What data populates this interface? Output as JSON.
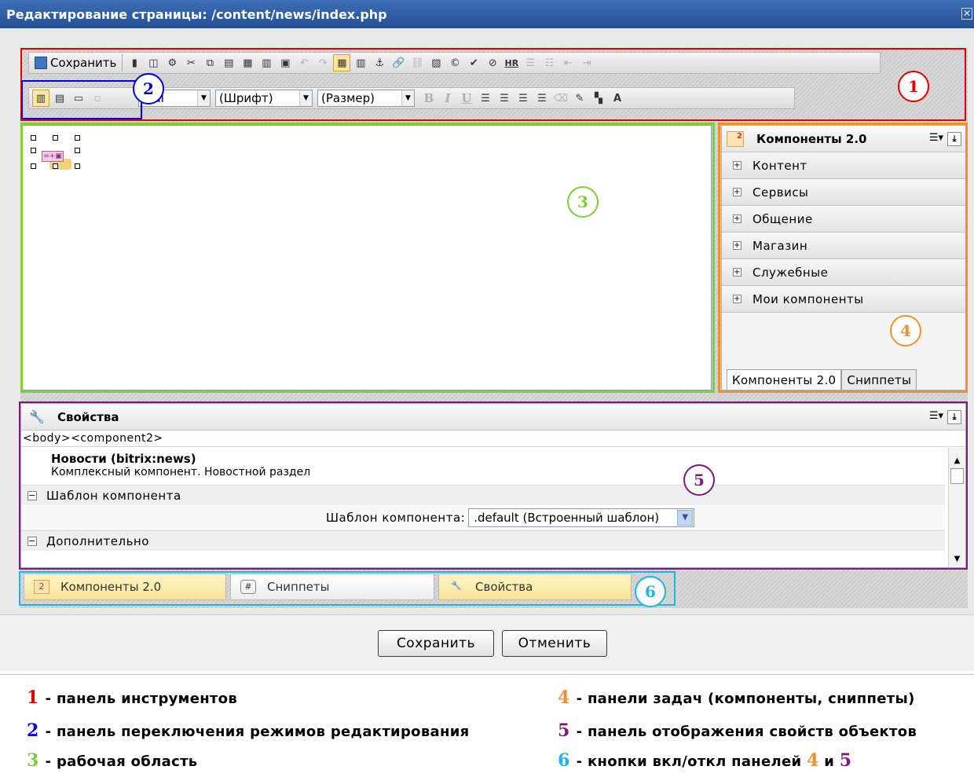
{
  "window": {
    "title": "Редактирование страницы: /content/news/index.php",
    "close_glyph": "✕"
  },
  "toolbar": {
    "save_label": "Сохранить",
    "style_select": "mal",
    "font_select": "(Шрифт)",
    "size_select": "(Размер)",
    "row1_icons": [
      "page-icon",
      "frame-icon",
      "settings-icon",
      "cut-icon",
      "copy-icon",
      "paste-icon",
      "paste-word-icon",
      "paste-text-icon",
      "select-all-icon",
      "undo-icon",
      "redo-icon",
      "table-border-icon",
      "table-icon",
      "anchor-icon",
      "link-icon",
      "unlink-icon",
      "image-icon",
      "copyright-icon",
      "spellcheck-icon",
      "flash-icon",
      "hr-icon",
      "ordered-list-icon",
      "unordered-list-icon",
      "outdent-icon",
      "indent-icon"
    ],
    "hr_label": "HR",
    "bold": "B",
    "italic": "I",
    "underline": "U",
    "mode_icons": [
      "wysiwyg-mode-icon",
      "code-mode-icon",
      "split-mode-icon",
      "compare-mode-icon"
    ]
  },
  "workarea": {
    "component_icon_text": "=+▣"
  },
  "components_panel": {
    "title": "Компоненты 2.0",
    "icon_text": "2",
    "groups": [
      "Контент",
      "Сервисы",
      "Общение",
      "Магазин",
      "Служебные",
      "Мои компоненты"
    ],
    "tabs": [
      "Компоненты 2.0",
      "Сниппеты"
    ],
    "menu_glyph": "☰▾",
    "pin_glyph": "⤓"
  },
  "properties_panel": {
    "title": "Свойства",
    "path": "<body><component2>",
    "component_name": "Новости (bitrix:news)",
    "component_desc": "Комплексный компонент. Новостной раздел",
    "section1": "Шаблон компонента",
    "template_label": "Шаблон компонента:",
    "template_value": ".default (Встроенный шаблон)",
    "section2": "Дополнительно"
  },
  "panel_toggles": [
    {
      "label": "Компоненты 2.0",
      "state": "on",
      "icon": "2"
    },
    {
      "label": "Сниппеты",
      "state": "off",
      "icon": "#"
    },
    {
      "label": "Свойства",
      "state": "on",
      "icon": "🔧"
    }
  ],
  "dialog_buttons": {
    "save": "Сохранить",
    "cancel": "Отменить"
  },
  "markers": [
    "1",
    "2",
    "3",
    "4",
    "5",
    "6"
  ],
  "legend": [
    {
      "num": "1",
      "text": "- панель инструментов",
      "color": "#e00000"
    },
    {
      "num": "2",
      "text": "- панель переключения режимов редактирования",
      "color": "#0000e0"
    },
    {
      "num": "3",
      "text": "- рабочая область",
      "color": "#7ccf3b"
    },
    {
      "num": "4",
      "text": "- панели задач (компоненты, сниппеты)",
      "color": "#f0902a"
    },
    {
      "num": "5",
      "text": "- панель отображения свойств объектов",
      "color": "#7a1a7a"
    },
    {
      "num": "6",
      "text": "- кнопки вкл/откл панелей",
      "color": "#1bb5e6",
      "extra": [
        "4",
        "и",
        "5"
      ]
    }
  ],
  "colors": {
    "marker1": "#e00000",
    "marker2": "#0000e0",
    "marker3": "#7ccf3b",
    "marker4": "#f0902a",
    "marker5": "#7a1a7a",
    "marker6": "#1bb5e6",
    "title_bar": "#2f5ea6"
  }
}
